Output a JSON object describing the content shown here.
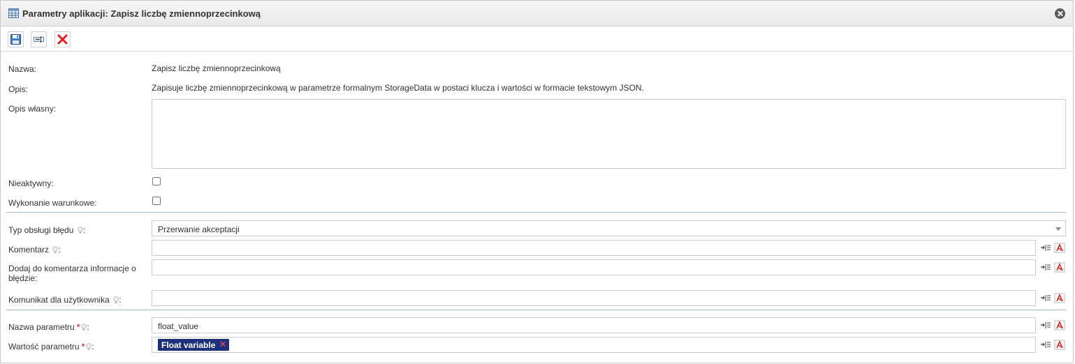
{
  "window": {
    "title": "Parametry aplikacji: Zapisz liczbę zmiennoprzecinkową",
    "title_icon": "table-icon",
    "close_icon": "close-circle-icon"
  },
  "toolbar": {
    "buttons": [
      {
        "icon": "save-icon"
      },
      {
        "icon": "label-icon"
      },
      {
        "icon": "delete-icon"
      }
    ]
  },
  "form": {
    "name_label": "Nazwa:",
    "name_value": "Zapisz liczbę zmiennoprzecinkową",
    "desc_label": "Opis:",
    "desc_value": "Zapisuje liczbę zmiennoprzecinkową w parametrze formalnym StorageData w postaci klucza i wartości w formacie tekstowym JSON.",
    "own_desc_label": "Opis własny:",
    "own_desc_value": "",
    "inactive_label": "Nieaktywny:",
    "inactive_checked": false,
    "conditional_label": "Wykonanie warunkowe:",
    "conditional_checked": false,
    "error_type_label": "Typ obsługi błędu",
    "error_type_value": "Przerwanie akceptacji",
    "comment_label": "Komentarz",
    "comment_value": "",
    "add_error_info_label_line1": "Dodaj do komentarza informacje o",
    "add_error_info_label_line2": "błędzie:",
    "add_error_info_value": "",
    "user_message_label": "Komunikat dla użytkownika",
    "user_message_value": "",
    "param_name_label": "Nazwa parametru",
    "param_name_value": "float_value",
    "param_value_label": "Wartość parametru",
    "param_value_tag": "Float variable",
    "required_marker": "*",
    "colon": ":"
  },
  "colors": {
    "tag_background": "#1e2f7c",
    "required": "#d43c3c",
    "separator": "#a9b8c4"
  }
}
